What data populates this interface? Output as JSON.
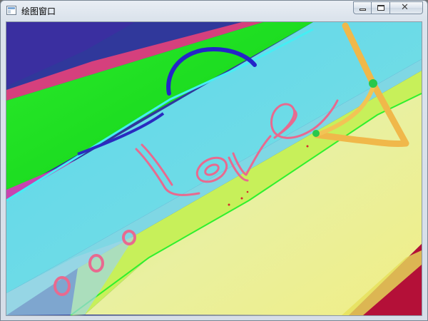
{
  "window": {
    "title": "绘图窗口",
    "icons": {
      "app": "window-app-icon",
      "minimize": "minimize-icon",
      "maximize": "maximize-icon",
      "close": "close-icon"
    }
  },
  "canvas": {
    "handwritten_text": "Love",
    "colors": {
      "background_blue": "#2f3fa8",
      "green_band": "#11e317",
      "cyan_band": "#65d9ea",
      "yellow_band": "#e3ee5a",
      "pink_outline": "#e86a8f",
      "orange_stroke": "#f0b84a",
      "red_corner": "#b40f3a"
    }
  }
}
